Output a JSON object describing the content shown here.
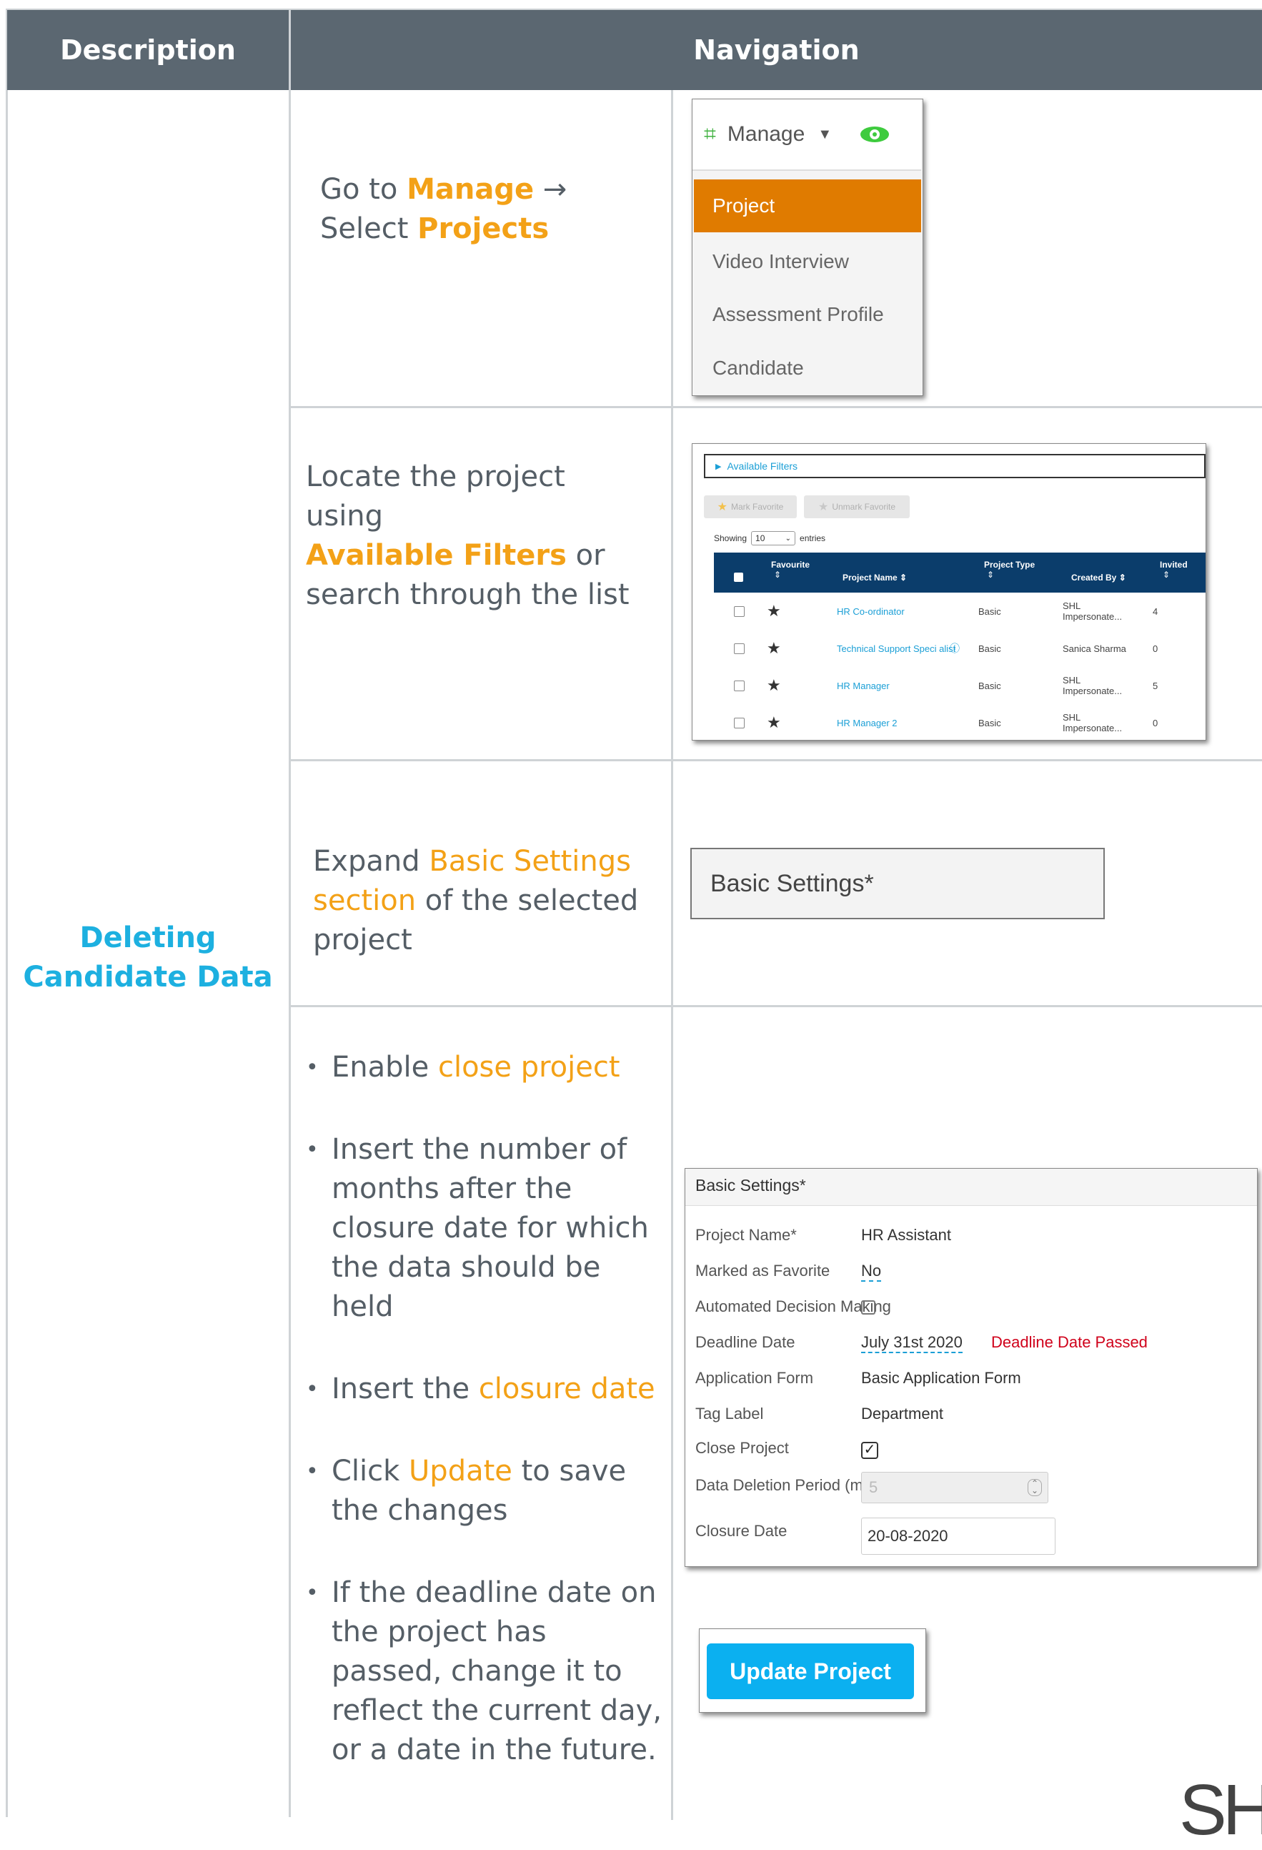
{
  "header": {
    "description": "Description",
    "navigation": "Navigation"
  },
  "section_title": "Deleting Candidate Data",
  "step1": {
    "text_go": "Go to ",
    "manage": "Manage",
    "arrow": " →",
    "text_select": "Select ",
    "projects": "Projects",
    "menu": {
      "button": "Manage",
      "items": [
        "Project",
        "Video Interview",
        "Assessment Profile",
        "Candidate"
      ]
    }
  },
  "step2": {
    "line1": "Locate the project",
    "line2": "using",
    "filters": "Available Filters",
    "or": " or",
    "line4": "search through the list",
    "shot": {
      "available_filters": "Available Filters",
      "mark_favorite": "Mark Favorite",
      "unmark_favorite": "Unmark Favorite",
      "showing": "Showing",
      "entries_value": "10",
      "entries": "entries",
      "columns": [
        "Favourite",
        "Project Name",
        "Project Type",
        "Created By",
        "Invited"
      ],
      "rows": [
        {
          "name": "HR Co-ordinator",
          "type": "Basic",
          "created": "SHL Impersonate...",
          "invited": "4"
        },
        {
          "name": "Technical Support Speci alist",
          "type": "Basic",
          "created": "Sanica Sharma",
          "invited": "0"
        },
        {
          "name": "HR Manager",
          "type": "Basic",
          "created": "SHL Impersonate...",
          "invited": "5"
        },
        {
          "name": "HR Manager 2",
          "type": "Basic",
          "created": "SHL Impersonate...",
          "invited": "0"
        }
      ]
    }
  },
  "step3": {
    "expand": "Expand ",
    "basic1": "Basic Settings",
    "basic2": "section",
    "rest1": " of the selected",
    "rest2": "project",
    "box_label": "Basic Settings*"
  },
  "step4": {
    "b1_pre": "Enable ",
    "b1_hl": "close project",
    "b2": [
      "Insert the number of",
      "months after the",
      "closure date for which",
      "the data should be",
      "held"
    ],
    "b3_pre": "Insert the ",
    "b3_hl": "closure date",
    "b4_pre": "Click ",
    "b4_hl": "Update",
    "b4_post": " to save",
    "b4_line2": "the changes",
    "b5": [
      "If the deadline date on",
      "the project has",
      "passed, change it to",
      "reflect the current day,",
      "or a date in the future."
    ],
    "form": {
      "title": "Basic Settings*",
      "project_name_label": "Project Name*",
      "project_name": "HR Assistant",
      "favorite_label": "Marked as Favorite",
      "favorite": "No",
      "adm_label": "Automated Decision Making",
      "deadline_label": "Deadline Date",
      "deadline": "July 31st 2020",
      "deadline_warning": "Deadline Date Passed",
      "app_form_label": "Application Form",
      "app_form": "Basic Application Form",
      "tag_label": "Tag Label",
      "tag": "Department",
      "close_label": "Close Project",
      "period_label": "Data Deletion Period (months)",
      "period_value": "5",
      "closure_label": "Closure Date",
      "closure_value": "20-08-2020"
    },
    "update_button": "Update Project"
  },
  "logo_text": "SH",
  "colors": {
    "header_bg": "#5b6771",
    "accent_orange": "#f3a117",
    "title_blue": "#1db0e0",
    "menu_orange": "#e07b00",
    "table_header": "#0b3d6b",
    "update_blue": "#0bb0f0",
    "warning_red": "#d0021b"
  }
}
